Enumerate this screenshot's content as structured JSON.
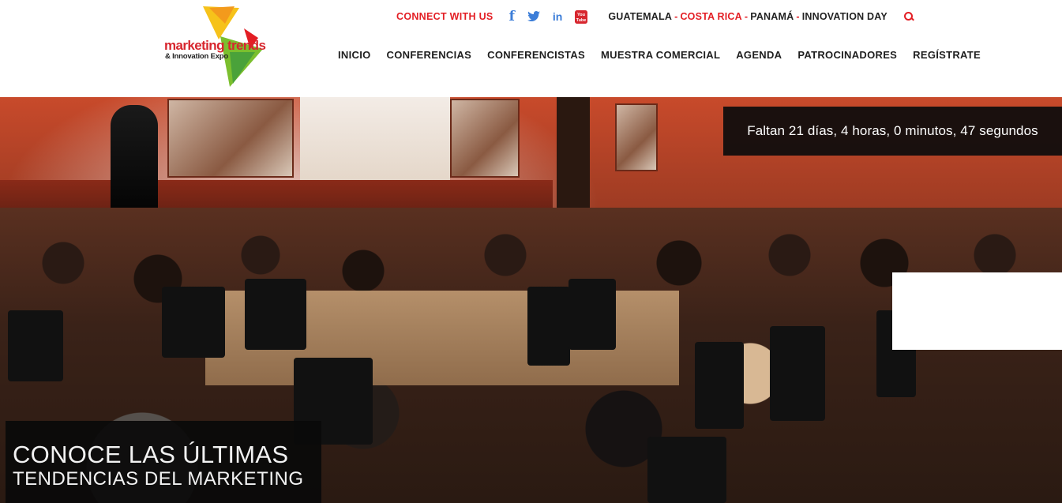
{
  "logo": {
    "title": "marketing trends",
    "subtitle": "& Innovation Expo"
  },
  "topbar": {
    "connect_label": "CONNECT WITH US",
    "social": [
      {
        "name": "facebook-icon",
        "glyph": "f"
      },
      {
        "name": "twitter-icon",
        "glyph": "🐦"
      },
      {
        "name": "linkedin-icon",
        "glyph": "in"
      },
      {
        "name": "youtube-icon",
        "glyph": "You Tube"
      }
    ],
    "countries": {
      "guatemala": "GUATEMALA",
      "sep": "-",
      "costa_rica": "COSTA RICA",
      "panama": "PANAMÁ",
      "innovation_day": "INNOVATION DAY"
    }
  },
  "nav": {
    "items": [
      "INICIO",
      "CONFERENCIAS",
      "CONFERENCISTAS",
      "MUESTRA COMERCIAL",
      "AGENDA",
      "PATROCINADORES",
      "REGÍSTRATE"
    ]
  },
  "hero": {
    "countdown": "Faltan 21 días, 4 horas, 0 minutos, 47 segundos",
    "tagline_line1": "CONOCE LAS ÚLTIMAS",
    "tagline_line2": "TENDENCIAS DEL MARKETING"
  },
  "colors": {
    "accent": "#e31e24",
    "social": "#3b7dd8",
    "text": "#1e1e1e"
  }
}
